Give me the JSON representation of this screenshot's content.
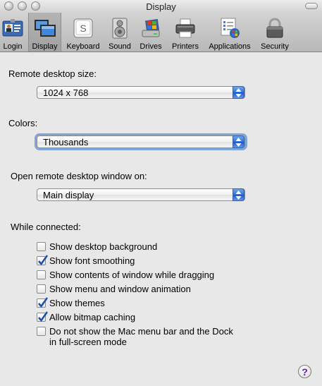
{
  "window": {
    "title": "Display"
  },
  "toolbar": {
    "items": [
      {
        "label": "Login",
        "icon": "login-badge-icon"
      },
      {
        "label": "Display",
        "icon": "display-monitors-icon"
      },
      {
        "label": "Keyboard",
        "icon": "keyboard-key-icon"
      },
      {
        "label": "Sound",
        "icon": "speaker-icon"
      },
      {
        "label": "Drives",
        "icon": "drive-icon"
      },
      {
        "label": "Printers",
        "icon": "printer-icon"
      },
      {
        "label": "Applications",
        "icon": "applications-window-icon"
      },
      {
        "label": "Security",
        "icon": "padlock-icon"
      }
    ],
    "selected": "Display",
    "keyboard_key_glyph": "S"
  },
  "remote_desktop_size": {
    "label": "Remote desktop size:",
    "value": "1024 x 768"
  },
  "colors": {
    "label": "Colors:",
    "value": "Thousands"
  },
  "open_on": {
    "label": "Open remote desktop window on:",
    "value": "Main display"
  },
  "while_connected": {
    "label": "While connected:",
    "options": [
      {
        "label": "Show desktop background",
        "checked": false
      },
      {
        "label": "Show font smoothing",
        "checked": true
      },
      {
        "label": "Show contents of window while dragging",
        "checked": false
      },
      {
        "label": "Show menu and window animation",
        "checked": false
      },
      {
        "label": "Show themes",
        "checked": true
      },
      {
        "label": "Allow bitmap caching",
        "checked": true
      },
      {
        "label": "Do not show the Mac menu bar and the Dock in full-screen mode",
        "line1": "Do not show the Mac menu bar and the Dock",
        "line2": "in full-screen mode",
        "checked": false
      }
    ]
  },
  "help": {
    "glyph": "?"
  },
  "colors_palette": {
    "accent": "#2f6fd7",
    "focus_ring": "#7ea6d8",
    "background": "#e8e8e8"
  }
}
